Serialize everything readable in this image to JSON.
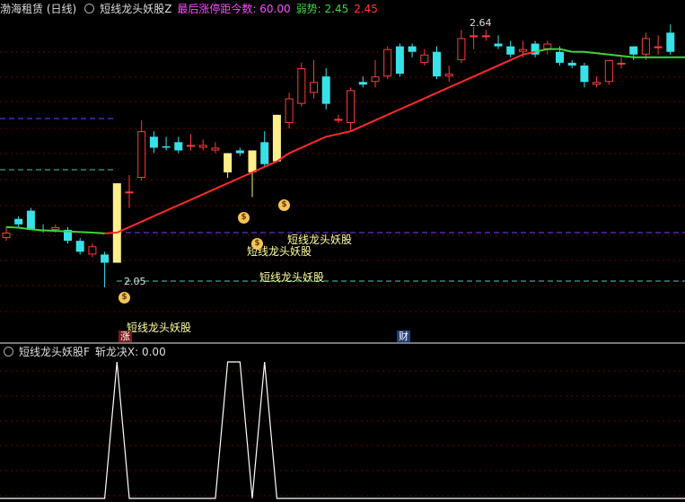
{
  "top_panel": {
    "title": "渤海租赁 (日线)",
    "indicator_name": "短线龙头妖股Z",
    "last_limit_up_label": "最后涨停距今数: 60.00",
    "weak_label": "弱势: 2.45",
    "weak_value2": "2.45",
    "high_label": "2.64",
    "low_label": "2.05",
    "signal_label": "短线龙头妖股",
    "marker_zhang": "涨",
    "marker_cai": "财",
    "bag_glyph": "$"
  },
  "bottom_panel": {
    "indicator_name": "短线龙头妖股F",
    "value_label": "斩龙决X: 0.00"
  },
  "colors": {
    "up": "#ff3b3b",
    "down": "#38e1e8",
    "limit_up": "#ffef8a",
    "ma_red": "#ff2a2a",
    "ma_green": "#3cd63c",
    "purple_text": "#ff4bff",
    "green_text": "#3cd63c",
    "red_text": "#ff3b3b"
  },
  "candles": [
    {
      "o": 2.23,
      "c": 2.25,
      "h": 2.27,
      "l": 2.22,
      "t": "up"
    },
    {
      "o": 2.3,
      "c": 2.28,
      "h": 2.31,
      "l": 2.27,
      "t": "down"
    },
    {
      "o": 2.33,
      "c": 2.26,
      "h": 2.34,
      "l": 2.26,
      "t": "down"
    },
    {
      "o": 2.26,
      "c": 2.255,
      "h": 2.28,
      "l": 2.25,
      "t": "down"
    },
    {
      "o": 2.26,
      "c": 2.27,
      "h": 2.28,
      "l": 2.25,
      "t": "up"
    },
    {
      "o": 2.26,
      "c": 2.22,
      "h": 2.27,
      "l": 2.21,
      "t": "down"
    },
    {
      "o": 2.22,
      "c": 2.18,
      "h": 2.23,
      "l": 2.17,
      "t": "down"
    },
    {
      "o": 2.17,
      "c": 2.2,
      "h": 2.21,
      "l": 2.16,
      "t": "up"
    },
    {
      "o": 2.17,
      "c": 2.14,
      "h": 2.18,
      "l": 2.05,
      "t": "down"
    },
    {
      "o": 2.14,
      "c": 2.43,
      "h": 2.43,
      "l": 2.14,
      "t": "limit"
    },
    {
      "o": 2.4,
      "c": 2.4,
      "h": 2.46,
      "l": 2.34,
      "t": "up"
    },
    {
      "o": 2.45,
      "c": 2.62,
      "h": 2.66,
      "l": 2.44,
      "t": "up"
    },
    {
      "o": 2.6,
      "c": 2.56,
      "h": 2.62,
      "l": 2.54,
      "t": "down"
    },
    {
      "o": 2.565,
      "c": 2.56,
      "h": 2.6,
      "l": 2.55,
      "t": "down"
    },
    {
      "o": 2.58,
      "c": 2.55,
      "h": 2.6,
      "l": 2.54,
      "t": "down"
    },
    {
      "o": 2.57,
      "c": 2.57,
      "h": 2.61,
      "l": 2.55,
      "t": "up"
    },
    {
      "o": 2.56,
      "c": 2.57,
      "h": 2.59,
      "l": 2.55,
      "t": "up"
    },
    {
      "o": 2.55,
      "c": 2.56,
      "h": 2.58,
      "l": 2.54,
      "t": "up"
    },
    {
      "o": 2.47,
      "c": 2.54,
      "h": 2.54,
      "l": 2.45,
      "t": "limit"
    },
    {
      "o": 2.55,
      "c": 2.54,
      "h": 2.56,
      "l": 2.53,
      "t": "down"
    },
    {
      "o": 2.47,
      "c": 2.55,
      "h": 2.55,
      "l": 2.38,
      "t": "limit"
    },
    {
      "o": 2.58,
      "c": 2.5,
      "h": 2.62,
      "l": 2.49,
      "t": "down"
    },
    {
      "o": 2.51,
      "c": 2.68,
      "h": 2.68,
      "l": 2.51,
      "t": "limit"
    },
    {
      "o": 2.65,
      "c": 2.74,
      "h": 2.76,
      "l": 2.63,
      "t": "up"
    },
    {
      "o": 2.72,
      "c": 2.85,
      "h": 2.87,
      "l": 2.71,
      "t": "up"
    },
    {
      "o": 2.76,
      "c": 2.8,
      "h": 2.88,
      "l": 2.74,
      "t": "up"
    },
    {
      "o": 2.82,
      "c": 2.72,
      "h": 2.85,
      "l": 2.7,
      "t": "down"
    },
    {
      "o": 2.66,
      "c": 2.665,
      "h": 2.68,
      "l": 2.65,
      "t": "up"
    },
    {
      "o": 2.65,
      "c": 2.77,
      "h": 2.78,
      "l": 2.62,
      "t": "up"
    },
    {
      "o": 2.8,
      "c": 2.79,
      "h": 2.82,
      "l": 2.78,
      "t": "down"
    },
    {
      "o": 2.8,
      "c": 2.82,
      "h": 2.88,
      "l": 2.78,
      "t": "up"
    },
    {
      "o": 2.82,
      "c": 2.92,
      "h": 2.93,
      "l": 2.81,
      "t": "up"
    },
    {
      "o": 2.93,
      "c": 2.83,
      "h": 2.94,
      "l": 2.82,
      "t": "down"
    },
    {
      "o": 2.93,
      "c": 2.91,
      "h": 2.94,
      "l": 2.89,
      "t": "down"
    },
    {
      "o": 2.87,
      "c": 2.9,
      "h": 2.92,
      "l": 2.86,
      "t": "up"
    },
    {
      "o": 2.91,
      "c": 2.82,
      "h": 2.93,
      "l": 2.81,
      "t": "down"
    },
    {
      "o": 2.82,
      "c": 2.83,
      "h": 2.86,
      "l": 2.8,
      "t": "up"
    },
    {
      "o": 2.88,
      "c": 2.96,
      "h": 2.99,
      "l": 2.87,
      "t": "up"
    },
    {
      "o": 2.97,
      "c": 2.97,
      "h": 3.0,
      "l": 2.92,
      "t": "up"
    },
    {
      "o": 2.965,
      "c": 2.97,
      "h": 2.99,
      "l": 2.95,
      "t": "up"
    },
    {
      "o": 2.94,
      "c": 2.93,
      "h": 2.97,
      "l": 2.92,
      "t": "down"
    },
    {
      "o": 2.93,
      "c": 2.9,
      "h": 2.95,
      "l": 2.89,
      "t": "down"
    },
    {
      "o": 2.91,
      "c": 2.92,
      "h": 2.95,
      "l": 2.89,
      "t": "up"
    },
    {
      "o": 2.94,
      "c": 2.9,
      "h": 2.95,
      "l": 2.89,
      "t": "down"
    },
    {
      "o": 2.92,
      "c": 2.94,
      "h": 2.95,
      "l": 2.9,
      "t": "up"
    },
    {
      "o": 2.91,
      "c": 2.87,
      "h": 2.93,
      "l": 2.86,
      "t": "down"
    },
    {
      "o": 2.87,
      "c": 2.86,
      "h": 2.88,
      "l": 2.85,
      "t": "down"
    },
    {
      "o": 2.86,
      "c": 2.8,
      "h": 2.87,
      "l": 2.78,
      "t": "down"
    },
    {
      "o": 2.8,
      "c": 2.79,
      "h": 2.82,
      "l": 2.78,
      "t": "up"
    },
    {
      "o": 2.8,
      "c": 2.88,
      "h": 2.88,
      "l": 2.79,
      "t": "up"
    },
    {
      "o": 2.87,
      "c": 2.87,
      "h": 2.89,
      "l": 2.85,
      "t": "up"
    },
    {
      "o": 2.93,
      "c": 2.9,
      "h": 2.93,
      "l": 2.88,
      "t": "down"
    },
    {
      "o": 2.9,
      "c": 2.96,
      "h": 2.98,
      "l": 2.88,
      "t": "up"
    },
    {
      "o": 2.93,
      "c": 2.93,
      "h": 2.97,
      "l": 2.9,
      "t": "up"
    },
    {
      "o": 2.98,
      "c": 2.91,
      "h": 3.01,
      "l": 2.9,
      "t": "down"
    }
  ],
  "ma": [
    2.27,
    2.268,
    2.262,
    2.258,
    2.256,
    2.254,
    2.252,
    2.25,
    2.247,
    2.25,
    2.27,
    2.29,
    2.31,
    2.33,
    2.35,
    2.37,
    2.39,
    2.41,
    2.43,
    2.45,
    2.47,
    2.49,
    2.51,
    2.54,
    2.56,
    2.58,
    2.6,
    2.61,
    2.62,
    2.64,
    2.66,
    2.68,
    2.7,
    2.72,
    2.74,
    2.76,
    2.78,
    2.8,
    2.82,
    2.84,
    2.86,
    2.88,
    2.9,
    2.91,
    2.92,
    2.92,
    2.91,
    2.91,
    2.905,
    2.9,
    2.895,
    2.89,
    2.89,
    2.89,
    2.89
  ],
  "ma_color_up": [
    false,
    false,
    false,
    false,
    false,
    false,
    false,
    false,
    false,
    true,
    true,
    true,
    true,
    true,
    true,
    true,
    true,
    true,
    true,
    true,
    true,
    true,
    true,
    true,
    true,
    true,
    true,
    true,
    true,
    true,
    true,
    true,
    true,
    true,
    true,
    true,
    true,
    true,
    true,
    true,
    true,
    true,
    true,
    true,
    false,
    false,
    false,
    false,
    false,
    false,
    false,
    false,
    false,
    false,
    false
  ],
  "bottom_signal": [
    0,
    0,
    0,
    0,
    0,
    0,
    0,
    0,
    0,
    1,
    0,
    0,
    0,
    0,
    0,
    0,
    0,
    0,
    1,
    1,
    0,
    1,
    0,
    0,
    0,
    0,
    0,
    0,
    0,
    0,
    0,
    0,
    0,
    0,
    0,
    0,
    0,
    0,
    0,
    0,
    0,
    0,
    0,
    0,
    0,
    0,
    0,
    0,
    0,
    0,
    0,
    0,
    0,
    0,
    0
  ]
}
